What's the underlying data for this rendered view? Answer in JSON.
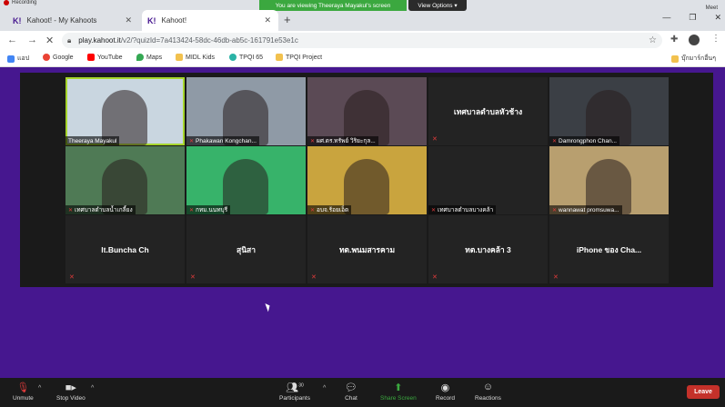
{
  "recording": {
    "label": "Recording"
  },
  "share_banner": "You are viewing Theeraya Mayakul's screen",
  "view_options": "View Options ▾",
  "meet_label": "Meet",
  "tabs": [
    {
      "label": "Kahoot! - My Kahoots",
      "favicon": "K!"
    },
    {
      "label": "Kahoot!",
      "favicon": "K!"
    }
  ],
  "url": {
    "host": "play.kahoot.it",
    "path": "/v2/?quizId=7a413424-58dc-46db-ab5c-161791e53e1c"
  },
  "bookmarks": [
    {
      "label": "แอป",
      "color": "#4285f4"
    },
    {
      "label": "Google",
      "color": "#ea4335"
    },
    {
      "label": "YouTube",
      "color": "#ff0000"
    },
    {
      "label": "Maps",
      "color": "#34a853"
    },
    {
      "label": "MIDL Kids",
      "color": "#f2c14e"
    },
    {
      "label": "TPQI 65",
      "color": "#2ab3a6"
    },
    {
      "label": "TPQI Project",
      "color": "#f2c14e"
    },
    {
      "label": "บุ๊กมาร์กอื่นๆ",
      "color": "#f2c14e"
    }
  ],
  "participants": [
    {
      "name": "Theeraya Mayakul",
      "video": true,
      "bg": "#c9d6e0",
      "active": true
    },
    {
      "name": "Phakawan Kongchan...",
      "video": true,
      "bg": "#8f9aa6",
      "muted": true
    },
    {
      "name": "ผศ.ดร.ทรัพย์ วิริยะกุล...",
      "video": true,
      "bg": "#5b4a55",
      "muted": true
    },
    {
      "name": "เทศบาลตำบลหัวช้าง",
      "video": false,
      "muted": true
    },
    {
      "name": "Damrongphon Chan...",
      "video": true,
      "bg": "#3b3f45",
      "muted": true
    },
    {
      "name": "เทศบาลตำบลน้ำเกลี้ยง",
      "video": true,
      "bg": "#4f7a55",
      "muted": true
    },
    {
      "name": "กทม.นนทบุรี",
      "video": true,
      "bg": "#37b36a",
      "muted": true
    },
    {
      "name": "อบจ.ร้อยเอ็ด",
      "video": true,
      "bg": "#c9a43e",
      "muted": true
    },
    {
      "name": "เทศบาลตำบลบางคล้า",
      "video": false,
      "muted": true,
      "label_only": true
    },
    {
      "name": "wannawat promsuwa...",
      "video": true,
      "bg": "#b89f6f",
      "muted": true
    },
    {
      "name": "lt.Buncha Ch",
      "video": false,
      "muted": true
    },
    {
      "name": "สุนิสา",
      "video": false,
      "muted": true
    },
    {
      "name": "ทต.พนมสารคาม",
      "video": false,
      "muted": true
    },
    {
      "name": "ทต.บางคล้า 3",
      "video": false,
      "muted": true
    },
    {
      "name": "iPhone ของ Cha...",
      "video": false,
      "muted": true
    }
  ],
  "zoombar": {
    "unmute": "Unmute",
    "stop_video": "Stop Video",
    "participants": "Participants",
    "participants_count": "30",
    "chat": "Chat",
    "share_screen": "Share Screen",
    "record": "Record",
    "reactions": "Reactions",
    "leave": "Leave"
  },
  "colors": {
    "kahoot_purple": "#46178f",
    "share_green": "#3ba83f",
    "leave_red": "#c4312a"
  }
}
